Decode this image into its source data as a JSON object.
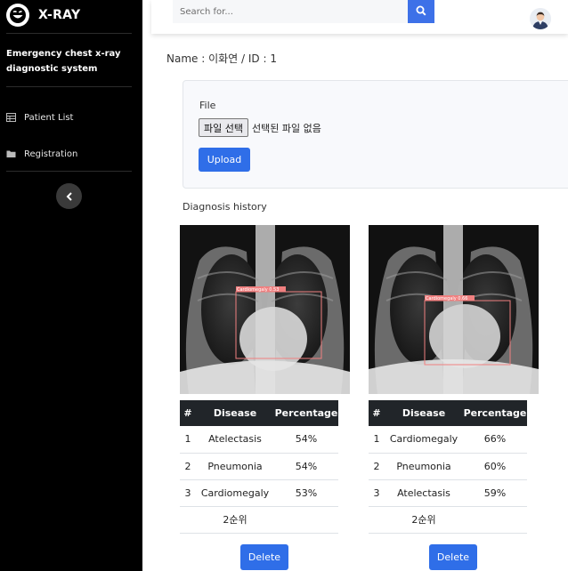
{
  "brand": {
    "title": "X-RAY",
    "system_name": "Emergency chest x-ray diagnostic system"
  },
  "sidebar": {
    "items": [
      {
        "label": "Patient List",
        "icon": "table-icon"
      },
      {
        "label": "Registration",
        "icon": "folder-icon"
      }
    ]
  },
  "search": {
    "placeholder": "Search for..."
  },
  "patient": {
    "line": "Name : 이화연 / ID : 1"
  },
  "upload": {
    "file_label": "File",
    "choose_label": "파일 선택",
    "no_file_text": "선택된 파일 없음",
    "upload_label": "Upload"
  },
  "history": {
    "title": "Diagnosis history",
    "records": [
      {
        "box_label": "Cardiomegaly 0.53",
        "headers": [
          "#",
          "Disease",
          "Percentage"
        ],
        "rows": [
          {
            "rank": "1",
            "disease": "Atelectasis",
            "pct": "54%"
          },
          {
            "rank": "2",
            "disease": "Pneumonia",
            "pct": "54%"
          },
          {
            "rank": "3",
            "disease": "Cardiomegaly",
            "pct": "53%"
          }
        ],
        "footer": "2순위",
        "delete_label": "Delete"
      },
      {
        "box_label": "Cardiomegaly 0.66",
        "headers": [
          "#",
          "Disease",
          "Percentage"
        ],
        "rows": [
          {
            "rank": "1",
            "disease": "Cardiomegaly",
            "pct": "66%"
          },
          {
            "rank": "2",
            "disease": "Pneumonia",
            "pct": "60%"
          },
          {
            "rank": "3",
            "disease": "Atelectasis",
            "pct": "59%"
          }
        ],
        "footer": "2순위",
        "delete_label": "Delete"
      }
    ]
  },
  "colors": {
    "sidebar": "#000000",
    "primary": "#2f6ee8",
    "table_header": "#212529",
    "bbox": "#f08080"
  }
}
